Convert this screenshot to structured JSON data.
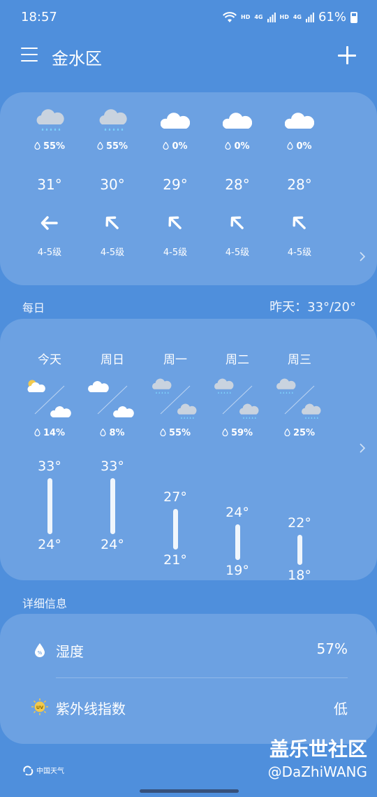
{
  "status": {
    "time": "18:57",
    "net1": "HD",
    "net2": "4G",
    "net3": "HD",
    "net4": "4G",
    "battery": "61%"
  },
  "header": {
    "city": "金水区"
  },
  "hourly": [
    {
      "icon": "rain-cloud-icon",
      "precip": "55%",
      "temp": "31°",
      "wind_dir": "left",
      "wind": "4-5级"
    },
    {
      "icon": "rain-cloud-icon",
      "precip": "55%",
      "temp": "30°",
      "wind_dir": "up-left",
      "wind": "4-5级"
    },
    {
      "icon": "cloud-icon",
      "precip": "0%",
      "temp": "29°",
      "wind_dir": "up-left",
      "wind": "4-5级"
    },
    {
      "icon": "cloud-icon",
      "precip": "0%",
      "temp": "28°",
      "wind_dir": "up-left",
      "wind": "4-5级"
    },
    {
      "icon": "cloud-icon",
      "precip": "0%",
      "temp": "28°",
      "wind_dir": "up-left",
      "wind": "4-5级"
    }
  ],
  "daily_section": {
    "label": "每日",
    "yesterday": "昨天：33°/20°"
  },
  "daily": [
    {
      "day": "今天",
      "day_icon": "partly-sunny-icon",
      "night_icon": "cloud-icon",
      "precip": "14%",
      "high": "33°",
      "low": "24°"
    },
    {
      "day": "周日",
      "day_icon": "cloud-icon",
      "night_icon": "cloud-icon",
      "precip": "8%",
      "high": "33°",
      "low": "24°"
    },
    {
      "day": "周一",
      "day_icon": "rain-cloud-icon",
      "night_icon": "rain-cloud-icon",
      "precip": "55%",
      "high": "27°",
      "low": "21°"
    },
    {
      "day": "周二",
      "day_icon": "rain-cloud-icon",
      "night_icon": "rain-cloud-icon",
      "precip": "59%",
      "high": "24°",
      "low": "19°"
    },
    {
      "day": "周三",
      "day_icon": "rain-cloud-icon",
      "night_icon": "rain-cloud-icon",
      "precip": "25%",
      "high": "22°",
      "low": "18°"
    }
  ],
  "details_section": {
    "label": "详细信息"
  },
  "details": {
    "humidity_label": "湿度",
    "humidity_value": "57%",
    "uv_label": "紫外线指数",
    "uv_value": "低",
    "uv_icon_text": "UV"
  },
  "footer": {
    "brand": "中国天气"
  },
  "watermark": {
    "line1": "盖乐世社区",
    "line2": "@DaZhiWANG"
  },
  "colors": {
    "background": "#4f8fdc",
    "card": "rgba(255,255,255,0.17)",
    "uv_badge": "#f2c94c"
  }
}
